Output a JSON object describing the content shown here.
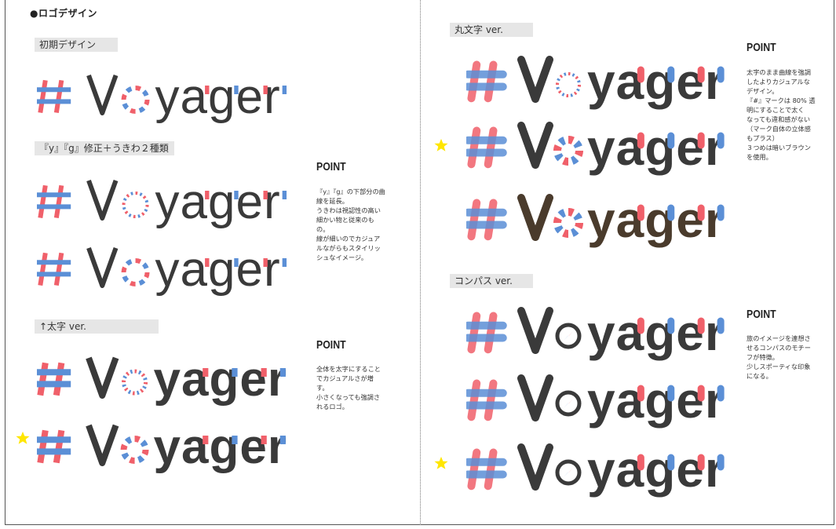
{
  "document": {
    "title": "●ロゴデザイン",
    "left_page": {
      "sections": [
        {
          "label": "初期デザイン"
        },
        {
          "label": "『y』『g』修正＋うきわ２種類"
        },
        {
          "label": "↑太字 ver."
        }
      ],
      "points": [
        {
          "title": "POINT",
          "lines": [
            "『y』『g』の下部分の曲",
            "線を延長。",
            "うきわは視認性の高い",
            "細かい物と従来のも",
            "の。",
            "線が細いのでカジュア",
            "ルながらもスタイリッ",
            "シュなイメージ。"
          ]
        },
        {
          "title": "POINT",
          "lines": [
            "全体を太字にすること",
            "でカジュアルさが増",
            "す。",
            "小さくなっても強調さ",
            "れるロゴ。"
          ]
        }
      ]
    },
    "right_page": {
      "sections": [
        {
          "label": "丸文字 ver."
        },
        {
          "label": "コンパス ver."
        }
      ],
      "points": [
        {
          "title": "POINT",
          "lines": [
            "太字のまま曲線を強調",
            "したよりカジュアルな",
            "デザイン。",
            "『#』マークは 80% 透",
            "明にすることで太く",
            "なっても違和感がない",
            "（マーク自体の立体感",
            "もプラス）",
            "３つめは暗いブラウン",
            "を使用。"
          ]
        },
        {
          "title": "POINT",
          "lines": [
            "旅のイメージを連想さ",
            "せるコンパスのモチー",
            "フが特徴。",
            "少しスポーティな印象",
            "になる。"
          ]
        }
      ]
    },
    "logo": {
      "name": "Voyager",
      "hash_symbol": "#",
      "letters": [
        "V",
        "o",
        "y",
        "a",
        "g",
        "e",
        "r"
      ]
    },
    "colors": {
      "red": "#f0606a",
      "blue": "#5b8fd6",
      "dark": "#3a3a3a",
      "brown": "#4a3b2c",
      "star": "#ffe600",
      "label_bg": "#e6e6e6"
    }
  }
}
